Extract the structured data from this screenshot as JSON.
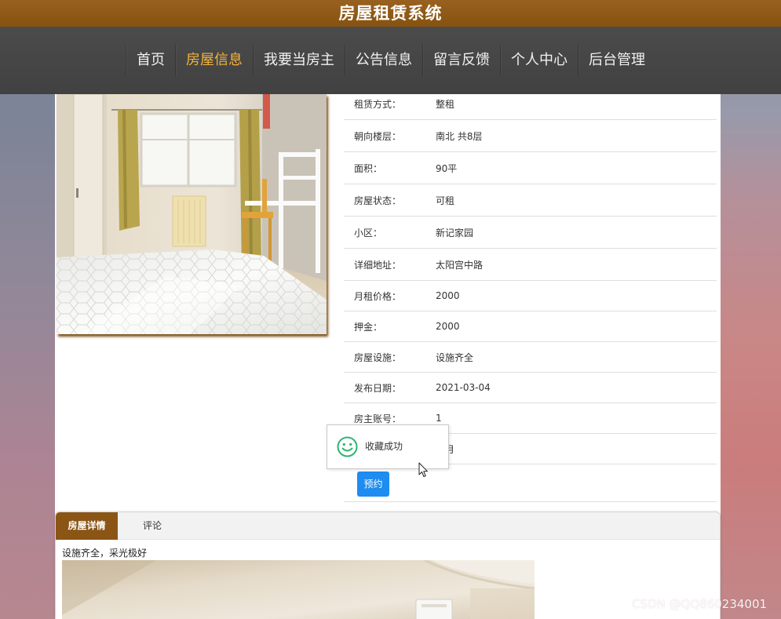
{
  "app": {
    "title": "房屋租赁系统"
  },
  "nav": {
    "items": [
      {
        "label": "首页",
        "active": false
      },
      {
        "label": "房屋信息",
        "active": true
      },
      {
        "label": "我要当房主",
        "active": false
      },
      {
        "label": "公告信息",
        "active": false
      },
      {
        "label": "留言反馈",
        "active": false
      },
      {
        "label": "个人中心",
        "active": false
      },
      {
        "label": "后台管理",
        "active": false
      }
    ]
  },
  "house": {
    "rows": [
      {
        "label": "租赁方式：",
        "value": "整租"
      },
      {
        "label": "朝向楼层：",
        "value": "南北 共8层"
      },
      {
        "label": "面积：",
        "value": "90平"
      },
      {
        "label": "房屋状态：",
        "value": "可租"
      },
      {
        "label": "小区：",
        "value": "新记家园"
      },
      {
        "label": "详细地址：",
        "value": "太阳宫中路"
      },
      {
        "label": "月租价格：",
        "value": "2000"
      },
      {
        "label": "押金：",
        "value": "2000"
      },
      {
        "label": "房屋设施：",
        "value": "设施齐全"
      },
      {
        "label": "发布日期：",
        "value": "2021-03-04"
      },
      {
        "label": "房主账号：",
        "value": "1"
      },
      {
        "label": "",
        "value": "月"
      }
    ],
    "book_label": "预约"
  },
  "toast": {
    "icon": "smile-icon",
    "message": "收藏成功"
  },
  "tabs": {
    "items": [
      {
        "label": "房屋详情",
        "active": true
      },
      {
        "label": "评论",
        "active": false
      }
    ]
  },
  "detail": {
    "description": "设施齐全，采光极好"
  },
  "watermark": "CSDN @QQ860234001",
  "colors": {
    "brand": "#8b5516",
    "nav_bg": "#464646",
    "nav_active": "#f2b33d",
    "button": "#1e8cf0",
    "toast_icon": "#2bb673"
  }
}
